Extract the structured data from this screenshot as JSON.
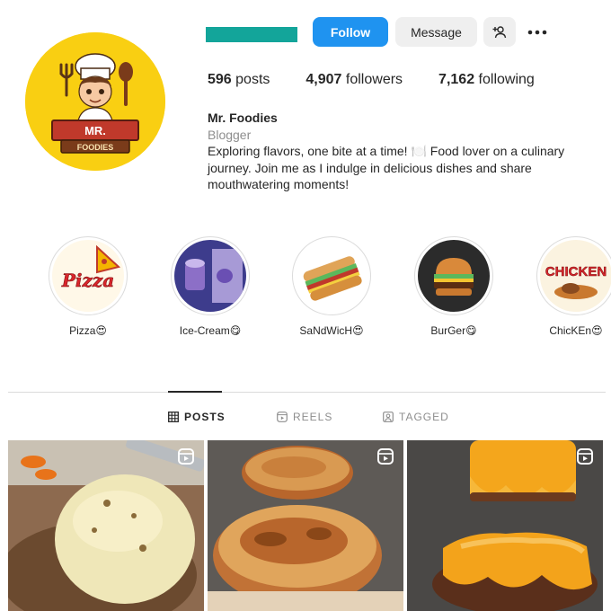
{
  "profile": {
    "follow_label": "Follow",
    "message_label": "Message",
    "stats": {
      "posts_count": "596",
      "posts_label": "posts",
      "followers_count": "4,907",
      "followers_label": "followers",
      "following_count": "7,162",
      "following_label": "following"
    },
    "name": "Mr. Foodies",
    "category": "Blogger",
    "bio": "Exploring flavors, one bite at a time! 🍽️ Food lover on a culinary journey. Join me as I indulge in delicious dishes and share mouthwatering moments!",
    "logo_text_top": "MR.",
    "logo_text_bottom": "FOODIES",
    "accent_color": "#1f93f0",
    "username_bar_color": "#13a59a",
    "avatar_bg_color": "#f9cf12"
  },
  "highlights": [
    {
      "label": "Pizza😍",
      "image_text": "Pizza"
    },
    {
      "label": "Ice-Cream😋"
    },
    {
      "label": "SaNdWicH😍"
    },
    {
      "label": "BurGer😋"
    },
    {
      "label": "ChicKEn😍",
      "image_text": "CHICKEN"
    }
  ],
  "tabs": [
    {
      "label": "POSTS",
      "icon": "grid-icon",
      "active": true
    },
    {
      "label": "REELS",
      "icon": "reels-icon",
      "active": false
    },
    {
      "label": "TAGGED",
      "icon": "tagged-icon",
      "active": false
    }
  ],
  "posts": [
    {
      "subject": "cheese-covered bun",
      "icon": "reel-icon"
    },
    {
      "subject": "toasted burger buns",
      "icon": "reel-icon"
    },
    {
      "subject": "melting cheese burger patties",
      "icon": "reel-icon"
    }
  ]
}
